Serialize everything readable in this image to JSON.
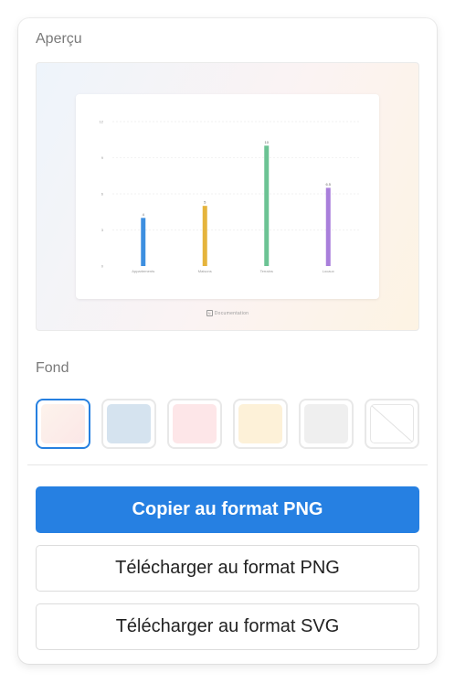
{
  "preview": {
    "title": "Aperçu",
    "watermark_text": "Documentation"
  },
  "chart_data": {
    "type": "bar",
    "categories": [
      "Appartements",
      "Maisons",
      "Terrains",
      "Locaux"
    ],
    "values": [
      4,
      5,
      10,
      6.5
    ],
    "data_labels": [
      "4",
      "5",
      "10",
      "6.5"
    ],
    "ylim": [
      0,
      12
    ],
    "yticks": [
      "0",
      "3",
      "6",
      "9",
      "12"
    ],
    "colors": [
      "#3d8fe0",
      "#e5b43c",
      "#6cc394",
      "#a97fdb"
    ],
    "grid": true
  },
  "background": {
    "title": "Fond",
    "swatches": [
      {
        "name": "gradient",
        "color": "#fbeee9",
        "selected": true
      },
      {
        "name": "blue",
        "color": "#d5e3ef",
        "selected": false
      },
      {
        "name": "pink",
        "color": "#fde6e8",
        "selected": false
      },
      {
        "name": "yellow",
        "color": "#fdf1d8",
        "selected": false
      },
      {
        "name": "gray",
        "color": "#efefef",
        "selected": false
      },
      {
        "name": "none",
        "color": "transparent",
        "selected": false
      }
    ]
  },
  "actions": {
    "copy_png": "Copier au format PNG",
    "download_png": "Télécharger au format PNG",
    "download_svg": "Télécharger au format SVG"
  },
  "colors": {
    "accent": "#2680e2"
  }
}
